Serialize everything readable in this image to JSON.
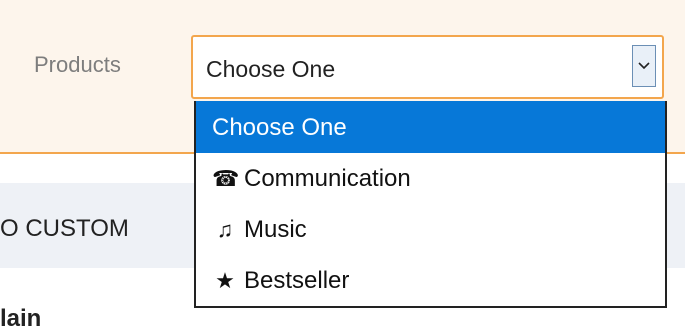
{
  "filter": {
    "label": "Products",
    "selected_value": "Choose One",
    "options": [
      {
        "label": "Choose One",
        "icon": "",
        "selected": true
      },
      {
        "label": "Communication",
        "icon": "☎",
        "icon_name": "telephone-icon"
      },
      {
        "label": "Music",
        "icon": "♫",
        "icon_name": "music-note-icon"
      },
      {
        "label": "Bestseller",
        "icon": "★",
        "icon_name": "star-icon"
      }
    ]
  },
  "page": {
    "section_heading": "O CUSTOM",
    "body_text": "lain"
  },
  "colors": {
    "accent_border": "#f3a64d",
    "selected_option_bg": "#0778d8",
    "band_bg": "#fdf5ec",
    "section_bg": "#eef1f6"
  }
}
